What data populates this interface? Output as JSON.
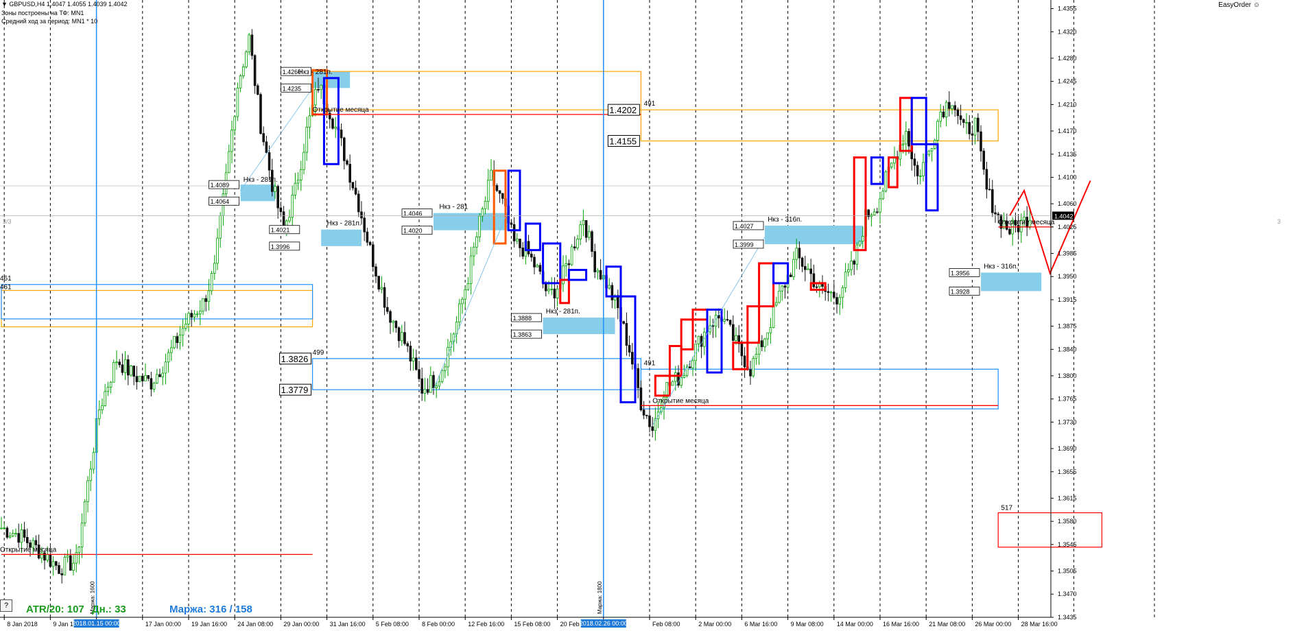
{
  "header": {
    "symbol_line": "GBPUSD,H4  1.4047 1.4055 1.4039 1.4042",
    "zones_line": "Зоны построены на ТФ: MN1",
    "avg_line": "Средний ход за период: MN1 * 10"
  },
  "easy_order": "EasyOrder",
  "help_button": "?",
  "side_left": "3/3",
  "side_right": "3",
  "footer": {
    "atr": "ATR/20: 107",
    "dn": "Дн.: 33",
    "margin": "Маржа: 316 / 158"
  },
  "colors": {
    "bull_candle": "#00a000",
    "bear_candle": "#111111",
    "zone_fill": "#87ceeb",
    "box_orange": "#ffa500",
    "box_blue": "#1e90ff",
    "line_red": "#ff0000",
    "renko_red": "#ff0000",
    "renko_blue": "#0000ff",
    "vline_blue": "#1e90ff",
    "grid": "#000000",
    "current_price": "#000000"
  },
  "chart_data": {
    "type": "candlestick",
    "symbol": "GBPUSD",
    "timeframe": "H4",
    "ylim": [
      1.3435,
      1.4368
    ],
    "y_ticks": [
      "1.4355",
      "1.4320",
      "1.4280",
      "1.4245",
      "1.4210",
      "1.4170",
      "1.4135",
      "1.4100",
      "1.4060",
      "1.4025",
      "1.3985",
      "1.3950",
      "1.3915",
      "1.3875",
      "1.3840",
      "1.3800",
      "1.3765",
      "1.3730",
      "1.3690",
      "1.3655",
      "1.3615",
      "1.3580",
      "1.3545",
      "1.3505",
      "1.3470",
      "1.3435"
    ],
    "current_price": "1.4042",
    "x_labels": [
      {
        "idx": 1,
        "text": "8 Jan 2018"
      },
      {
        "idx": 17,
        "text": "9 Jan 16:00"
      },
      {
        "idx": 33,
        "text": "2018.01.15 00:00",
        "highlight": true
      },
      {
        "idx": 49,
        "text": "17 Jan 00:00"
      },
      {
        "idx": 65,
        "text": "19 Jan 16:00"
      },
      {
        "idx": 81,
        "text": "24 Jan 08:00"
      },
      {
        "idx": 97,
        "text": "29 Jan 00:00"
      },
      {
        "idx": 113,
        "text": "31 Jan 16:00"
      },
      {
        "idx": 129,
        "text": "5 Feb 08:00"
      },
      {
        "idx": 145,
        "text": "8 Feb 00:00"
      },
      {
        "idx": 161,
        "text": "12 Feb 16:00"
      },
      {
        "idx": 177,
        "text": "15 Feb 08:00"
      },
      {
        "idx": 193,
        "text": "20 Feb 00:00"
      },
      {
        "idx": 209,
        "text": "2018.02.26 00:00",
        "highlight": true
      },
      {
        "idx": 225,
        "text": "Feb 08:00"
      },
      {
        "idx": 241,
        "text": "2 Mar 00:00"
      },
      {
        "idx": 257,
        "text": "6 Mar 16:00"
      },
      {
        "idx": 273,
        "text": "9 Mar 08:00"
      },
      {
        "idx": 289,
        "text": "14 Mar 00:00"
      },
      {
        "idx": 305,
        "text": "16 Mar 16:00"
      },
      {
        "idx": 321,
        "text": "21 Mar 08:00"
      },
      {
        "idx": 337,
        "text": "26 Mar 00:00"
      },
      {
        "idx": 353,
        "text": "28 Mar 16:00"
      }
    ],
    "n_bars": 365,
    "anchors": [
      [
        0,
        1.357
      ],
      [
        6,
        1.356
      ],
      [
        12,
        1.354
      ],
      [
        20,
        1.351
      ],
      [
        26,
        1.352
      ],
      [
        28,
        1.358
      ],
      [
        34,
        1.375
      ],
      [
        40,
        1.3825
      ],
      [
        46,
        1.38
      ],
      [
        52,
        1.379
      ],
      [
        58,
        1.383
      ],
      [
        64,
        1.388
      ],
      [
        70,
        1.391
      ],
      [
        74,
        1.396
      ],
      [
        78,
        1.41
      ],
      [
        82,
        1.424
      ],
      [
        86,
        1.431
      ],
      [
        90,
        1.418
      ],
      [
        94,
        1.409
      ],
      [
        98,
        1.402
      ],
      [
        102,
        1.408
      ],
      [
        106,
        1.417
      ],
      [
        110,
        1.424
      ],
      [
        114,
        1.42
      ],
      [
        118,
        1.415
      ],
      [
        124,
        1.406
      ],
      [
        128,
        1.399
      ],
      [
        134,
        1.39
      ],
      [
        140,
        1.385
      ],
      [
        146,
        1.378
      ],
      [
        152,
        1.38
      ],
      [
        158,
        1.388
      ],
      [
        162,
        1.395
      ],
      [
        166,
        1.403
      ],
      [
        170,
        1.41
      ],
      [
        174,
        1.406
      ],
      [
        178,
        1.4
      ],
      [
        182,
        1.399
      ],
      [
        186,
        1.396
      ],
      [
        190,
        1.392
      ],
      [
        194,
        1.394
      ],
      [
        198,
        1.399
      ],
      [
        202,
        1.404
      ],
      [
        206,
        1.397
      ],
      [
        210,
        1.394
      ],
      [
        214,
        1.39
      ],
      [
        218,
        1.384
      ],
      [
        222,
        1.376
      ],
      [
        226,
        1.372
      ],
      [
        230,
        1.378
      ],
      [
        236,
        1.38
      ],
      [
        242,
        1.385
      ],
      [
        246,
        1.388
      ],
      [
        250,
        1.389
      ],
      [
        256,
        1.384
      ],
      [
        260,
        1.381
      ],
      [
        266,
        1.387
      ],
      [
        270,
        1.392
      ],
      [
        276,
        1.398
      ],
      [
        280,
        1.396
      ],
      [
        284,
        1.393
      ],
      [
        290,
        1.392
      ],
      [
        296,
        1.397
      ],
      [
        300,
        1.404
      ],
      [
        304,
        1.406
      ],
      [
        310,
        1.413
      ],
      [
        314,
        1.417
      ],
      [
        318,
        1.41
      ],
      [
        322,
        1.414
      ],
      [
        326,
        1.42
      ],
      [
        330,
        1.422
      ],
      [
        334,
        1.417
      ],
      [
        338,
        1.418
      ],
      [
        342,
        1.408
      ],
      [
        346,
        1.404
      ],
      [
        350,
        1.402
      ],
      [
        354,
        1.403
      ],
      [
        357,
        1.4042
      ]
    ],
    "zone_labels": [
      {
        "text": "1.4260"
      },
      {
        "text": "1.4235"
      },
      {
        "text": "1.4089"
      },
      {
        "text": "1.4064"
      },
      {
        "text": "1.4021"
      },
      {
        "text": "1.3996"
      },
      {
        "text": "1.4046"
      },
      {
        "text": "1.4020"
      },
      {
        "text": "1.3888"
      },
      {
        "text": "1.3863"
      },
      {
        "text": "1.4027"
      },
      {
        "text": "1.3999"
      },
      {
        "text": "1.3956"
      },
      {
        "text": "1.3928"
      }
    ],
    "big_labels": [
      "1.4202",
      "1.4155",
      "1.3826",
      "1.3779"
    ],
    "box_counts": [
      "491",
      "499",
      "491",
      "517",
      "461",
      "461"
    ],
    "annotations": {
      "nkz_281": "Нкз - 281п.",
      "nkz_281_cut": "Нкз - 281",
      "nkz_316": "Нкз - 316п.",
      "month_open": "Открытие месяца",
      "margin_1600": "Маржа: 1600",
      "margin_1800": "Маржа: 1800"
    }
  }
}
